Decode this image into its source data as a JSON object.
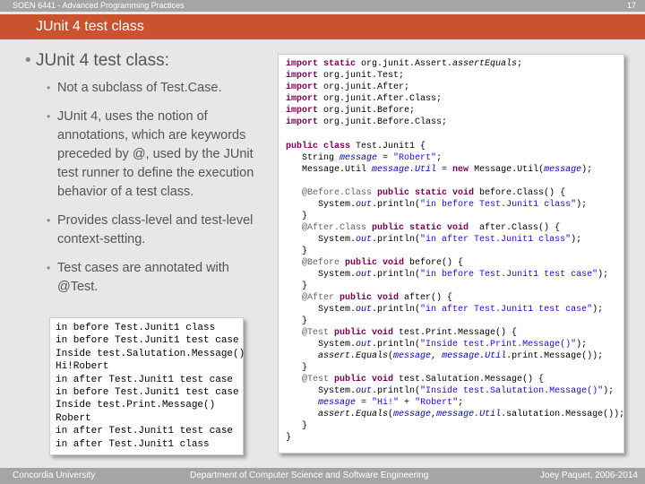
{
  "header": {
    "course": "SOEN 6441 - Advanced Programming Practices",
    "page_number": "17"
  },
  "slide": {
    "title": "JUnit 4 test class"
  },
  "bullets": {
    "main": "JUnit 4 test class:",
    "items": [
      "Not a subclass of Test.Case.",
      "JUnit 4, uses the notion of annotations, which are keywords preceded by @, used by the JUnit test runner to define the execution behavior of a test class.",
      "Provides class-level and test-level context-setting.",
      "Test cases are annotated with @Test."
    ]
  },
  "output_lines": [
    "in before Test.Junit1 class",
    "in before Test.Junit1 test case",
    "Inside test.Salutation.Message()",
    "Hi!Robert",
    "in after Test.Junit1 test case",
    "in before Test.Junit1 test case",
    "Inside test.Print.Message()",
    "Robert",
    "in after Test.Junit1 test case",
    "in after Test.Junit1 class"
  ],
  "code": {
    "imports": [
      {
        "kw": "import static",
        "rest": " org.junit.Assert.",
        "itl": "assertEquals",
        "end": ";"
      },
      {
        "kw": "import",
        "rest": " org.junit.Test;",
        "itl": "",
        "end": ""
      },
      {
        "kw": "import",
        "rest": " org.junit.After;",
        "itl": "",
        "end": ""
      },
      {
        "kw": "import",
        "rest": " org.junit.After.Class;",
        "itl": "",
        "end": ""
      },
      {
        "kw": "import",
        "rest": " org.junit.Before;",
        "itl": "",
        "end": ""
      },
      {
        "kw": "import",
        "rest": " org.junit.Before.Class;",
        "itl": "",
        "end": ""
      }
    ],
    "class_decl": {
      "kw": "public class",
      "rest": " Test.Junit1 {"
    },
    "field1": {
      "type": "String ",
      "name": "message",
      "eq": " = ",
      "value": "\"Robert\"",
      "end": ";"
    },
    "field2": {
      "type": "Message.Util ",
      "name": "message.Util",
      "eq": " = ",
      "kw": "new",
      "rest": " Message.Util(",
      "arg": "message",
      "end": ");"
    },
    "blocks": [
      {
        "ann": "@Before.Class",
        "kw": " public static void",
        "sig": " before.Class() {",
        "body": "System.",
        "out": "out",
        "call": ".println(",
        "str": "\"in before Test.Junit1 class\"",
        "end": ");"
      },
      {
        "ann": "@After.Class",
        "kw": " public static void",
        "sig": "  after.Class() {",
        "body": "System.",
        "out": "out",
        "call": ".println(",
        "str": "\"in after Test.Junit1 class\"",
        "end": ");"
      },
      {
        "ann": "@Before",
        "kw": " public void",
        "sig": " before() {",
        "body": "System.",
        "out": "out",
        "call": ".println(",
        "str": "\"in before Test.Junit1 test case\"",
        "end": ");"
      },
      {
        "ann": "@After",
        "kw": " public void",
        "sig": " after() {",
        "body": "System.",
        "out": "out",
        "call": ".println(",
        "str": "\"in after Test.Junit1 test case\"",
        "end": ");"
      }
    ],
    "test1": {
      "ann": "@Test",
      "kw": " public void",
      "sig": " test.Print.Message() {",
      "l1": {
        "body": "System.",
        "out": "out",
        "call": ".println(",
        "str": "\"Inside test.Print.Message()\"",
        "end": ");"
      },
      "l2": {
        "fn": "assert.Equals",
        "a": "(",
        "f1": "message",
        "b": ", ",
        "f2": "message.Util",
        "c": ".print.Message());"
      }
    },
    "test2": {
      "ann": "@Test",
      "kw": " public void",
      "sig": " test.Salutation.Message() {",
      "l1": {
        "body": "System.",
        "out": "out",
        "call": ".println(",
        "str": "\"Inside test.Salutation.Message()\"",
        "end": ");"
      },
      "l2": {
        "f1": "message",
        "eq": " = ",
        "s1": "\"Hi!\"",
        "plus": " + ",
        "s2": "\"Robert\"",
        "end": ";"
      },
      "l3": {
        "fn": "assert.Equals",
        "a": "(",
        "f1": "message",
        "b": ",",
        "f2": "message.Util",
        "c": ".salutation.Message());"
      }
    },
    "close_brace": "}",
    "class_close": "}"
  },
  "footer": {
    "left": "Concordia University",
    "center": "Department of Computer Science and Software Engineering",
    "right": "Joey Paquet, 2006-2014"
  }
}
